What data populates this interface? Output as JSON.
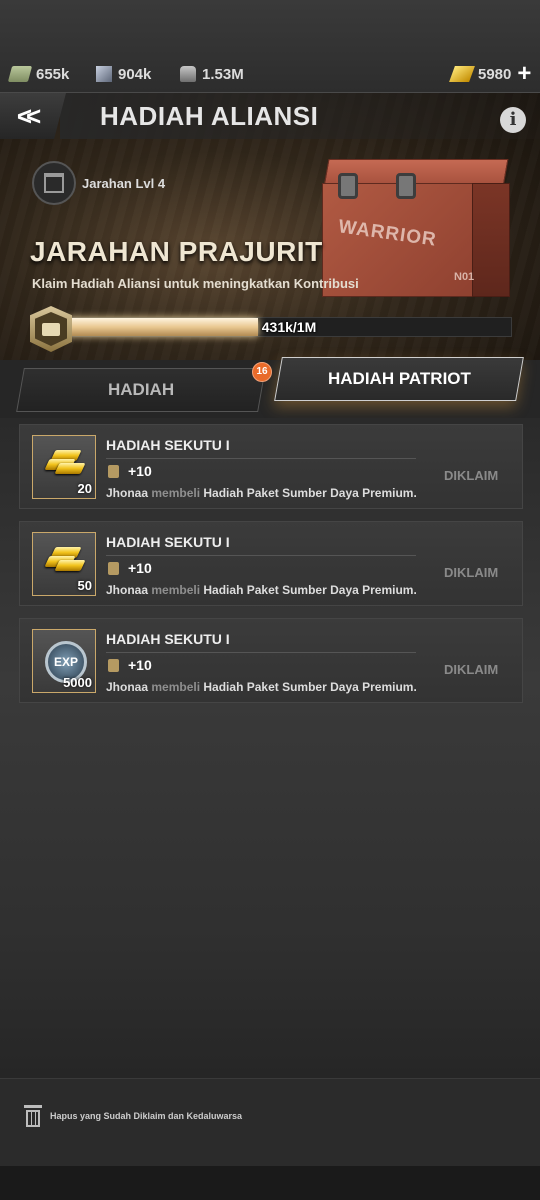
{
  "resources": {
    "cash": "655k",
    "steel": "904k",
    "oil": "1.53M",
    "gold": "5980"
  },
  "header": {
    "title": "HADIAH ALIANSI"
  },
  "banner": {
    "loot_level": "Jarahan Lvl 4",
    "loot_name": "JARAHAN PRAJURIT",
    "subtitle": "Klaim Hadiah Aliansi untuk meningkatkan Kontribusi",
    "crate_label": "WARRIOR",
    "crate_number": "N01",
    "progress_text": "431k/1M",
    "progress_value": 0.431
  },
  "tabs": {
    "rewards": "HADIAH",
    "rewards_count": "16",
    "patriot": "HADIAH PATRIOT"
  },
  "rewards": [
    {
      "title": "HADIAH SEKUTU I",
      "qty": "20",
      "icon": "gold-bars-icon",
      "points": "+10",
      "buyer": "Jhonaa",
      "verb": "membeli",
      "item": "Hadiah Paket Sumber Daya Premium.",
      "status": "DIKLAIM"
    },
    {
      "title": "HADIAH SEKUTU I",
      "qty": "50",
      "icon": "gold-bars-icon",
      "points": "+10",
      "buyer": "Jhonaa",
      "verb": "membeli",
      "item": "Hadiah Paket Sumber Daya Premium.",
      "status": "DIKLAIM"
    },
    {
      "title": "HADIAH SEKUTU I",
      "qty": "5000",
      "icon": "exp-icon",
      "exp_label": "EXP",
      "points": "+10",
      "buyer": "Jhonaa",
      "verb": "membeli",
      "item": "Hadiah Paket Sumber Daya Premium.",
      "status": "DIKLAIM"
    }
  ],
  "footer": {
    "clear_label": "Hapus yang Sudah Diklaim dan Kedaluwarsa"
  },
  "colors": {
    "accent_gold": "#caa86a",
    "badge_orange": "#e96b2b"
  }
}
